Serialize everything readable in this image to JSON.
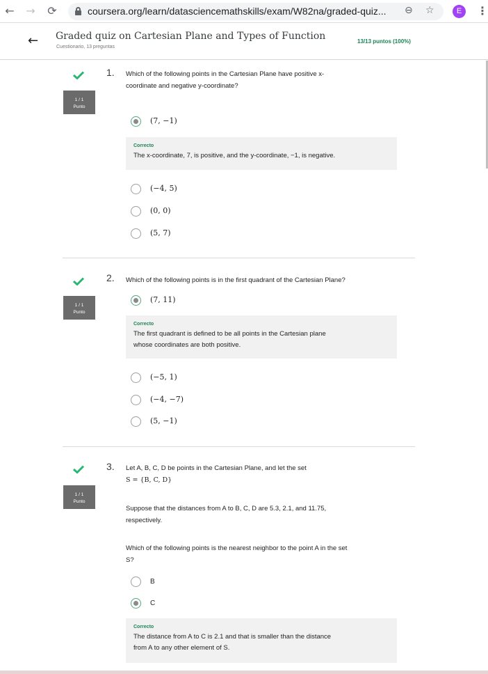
{
  "browser": {
    "back": "←",
    "forward": "→",
    "reload": "⟳",
    "url": "coursera.org/learn/datasciencemathskills/exam/W82na/graded-quiz...",
    "zoom_icon": "⊖",
    "star_icon": "☆",
    "avatar_letter": "E",
    "menu": "⋮"
  },
  "quiz": {
    "back": "←",
    "title": "Graded quiz on Cartesian Plane and Types of Function",
    "subtitle": "Cuestionario, 13 preguntas",
    "score": "13/13 puntos (100%)"
  },
  "questions": [
    {
      "number": "1.",
      "points_line1": "1 / 1",
      "points_line2": "Punto",
      "text": [
        "Which of the following points in the Cartesian Plane have positive x-",
        "coordinate and negative y-coordinate?"
      ],
      "selected": "(7, −1)",
      "feedback_title": "Correcto",
      "feedback": [
        "The x-coordinate, 7, is positive, and the y-coordinate, −1, is negative."
      ],
      "options": [
        "(−4, 5)",
        "(0, 0)",
        "(5, 7)"
      ]
    },
    {
      "number": "2.",
      "points_line1": "1 / 1",
      "points_line2": "Punto",
      "text": [
        "Which of the following points is in the first quadrant of the Cartesian Plane?"
      ],
      "selected": "(7, 11)",
      "feedback_title": "Correcto",
      "feedback": [
        "The first quadrant is defined to be all points in the Cartesian plane",
        "whose coordinates are both positive."
      ],
      "options": [
        "(−5, 1)",
        "(−4, −7)",
        "(5, −1)"
      ]
    },
    {
      "number": "3.",
      "points_line1": "1 / 1",
      "points_line2": "Punto",
      "text": [
        "Let A, B, C, D be points in the Cartesian Plane, and let the set",
        "S = {B, C, D}"
      ],
      "text2": [
        "Suppose that the distances from A to B, C, D are 5.3, 2.1, and 11.75,",
        "respectively."
      ],
      "text3": [
        "Which of the following points is the nearest neighbor to the point A in the set",
        "S?"
      ],
      "option_b": "B",
      "selected": "C",
      "feedback_title": "Correcto",
      "feedback": [
        "The distance from A to C is 2.1 and that is smaller than the distance",
        "from A to any other element of S."
      ]
    }
  ]
}
